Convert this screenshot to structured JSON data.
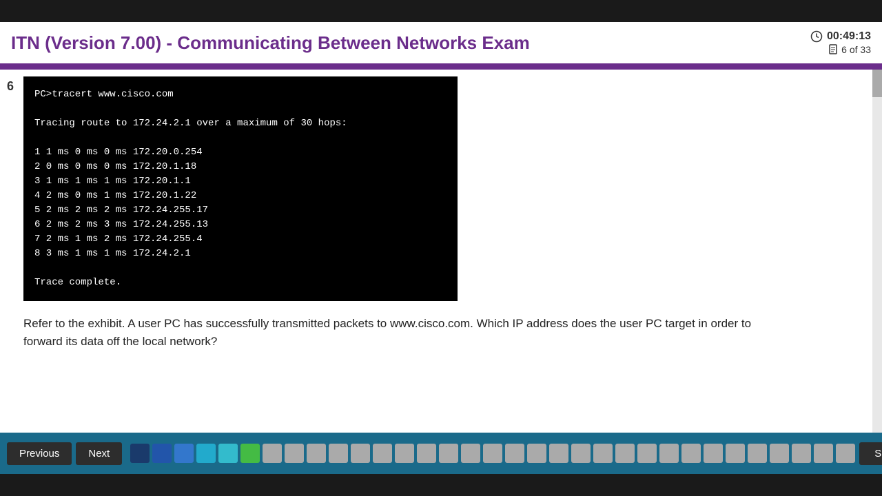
{
  "header": {
    "title": "ITN (Version 7.00) - Communicating Between Networks Exam",
    "timer": "00:49:13",
    "page_current": "6",
    "page_total": "33",
    "page_label": "6 of 33"
  },
  "question": {
    "number": "6",
    "terminal_lines": [
      "PC>tracert www.cisco.com",
      "",
      "Tracing route to 172.24.2.1 over a maximum of 30 hops:",
      "",
      "  1    1 ms     0 ms     0 ms   172.20.0.254",
      "  2    0 ms     0 ms     0 ms   172.20.1.18",
      "  3    1 ms     1 ms     1 ms   172.20.1.1",
      "  4    2 ms     0 ms     1 ms   172.20.1.22",
      "  5    2 ms     2 ms     2 ms   172.24.255.17",
      "  6    2 ms     2 ms     3 ms   172.24.255.13",
      "  7    2 ms     1 ms     2 ms   172.24.255.4",
      "  8    3 ms     1 ms     1 ms   172.24.2.1",
      "",
      "Trace complete."
    ],
    "text": "Refer to the exhibit. A user PC has successfully transmitted packets to www.cisco.com. Which IP address does the user PC target in order to forward its data off the local network?"
  },
  "navigation": {
    "previous_label": "Previous",
    "next_label": "Next",
    "submit_label": "Submit"
  },
  "dots": {
    "total": 33,
    "filled_dark": [
      1,
      2
    ],
    "filled_mid": [
      3
    ],
    "filled_light": [
      4
    ],
    "filled_cyan": [
      5
    ],
    "filled_teal": [],
    "filled_green": [
      6
    ],
    "colors": [
      "#1a3a6b",
      "#2255aa",
      "#3377cc",
      "#22aacc",
      "#33bbcc",
      "#44bb44"
    ]
  }
}
